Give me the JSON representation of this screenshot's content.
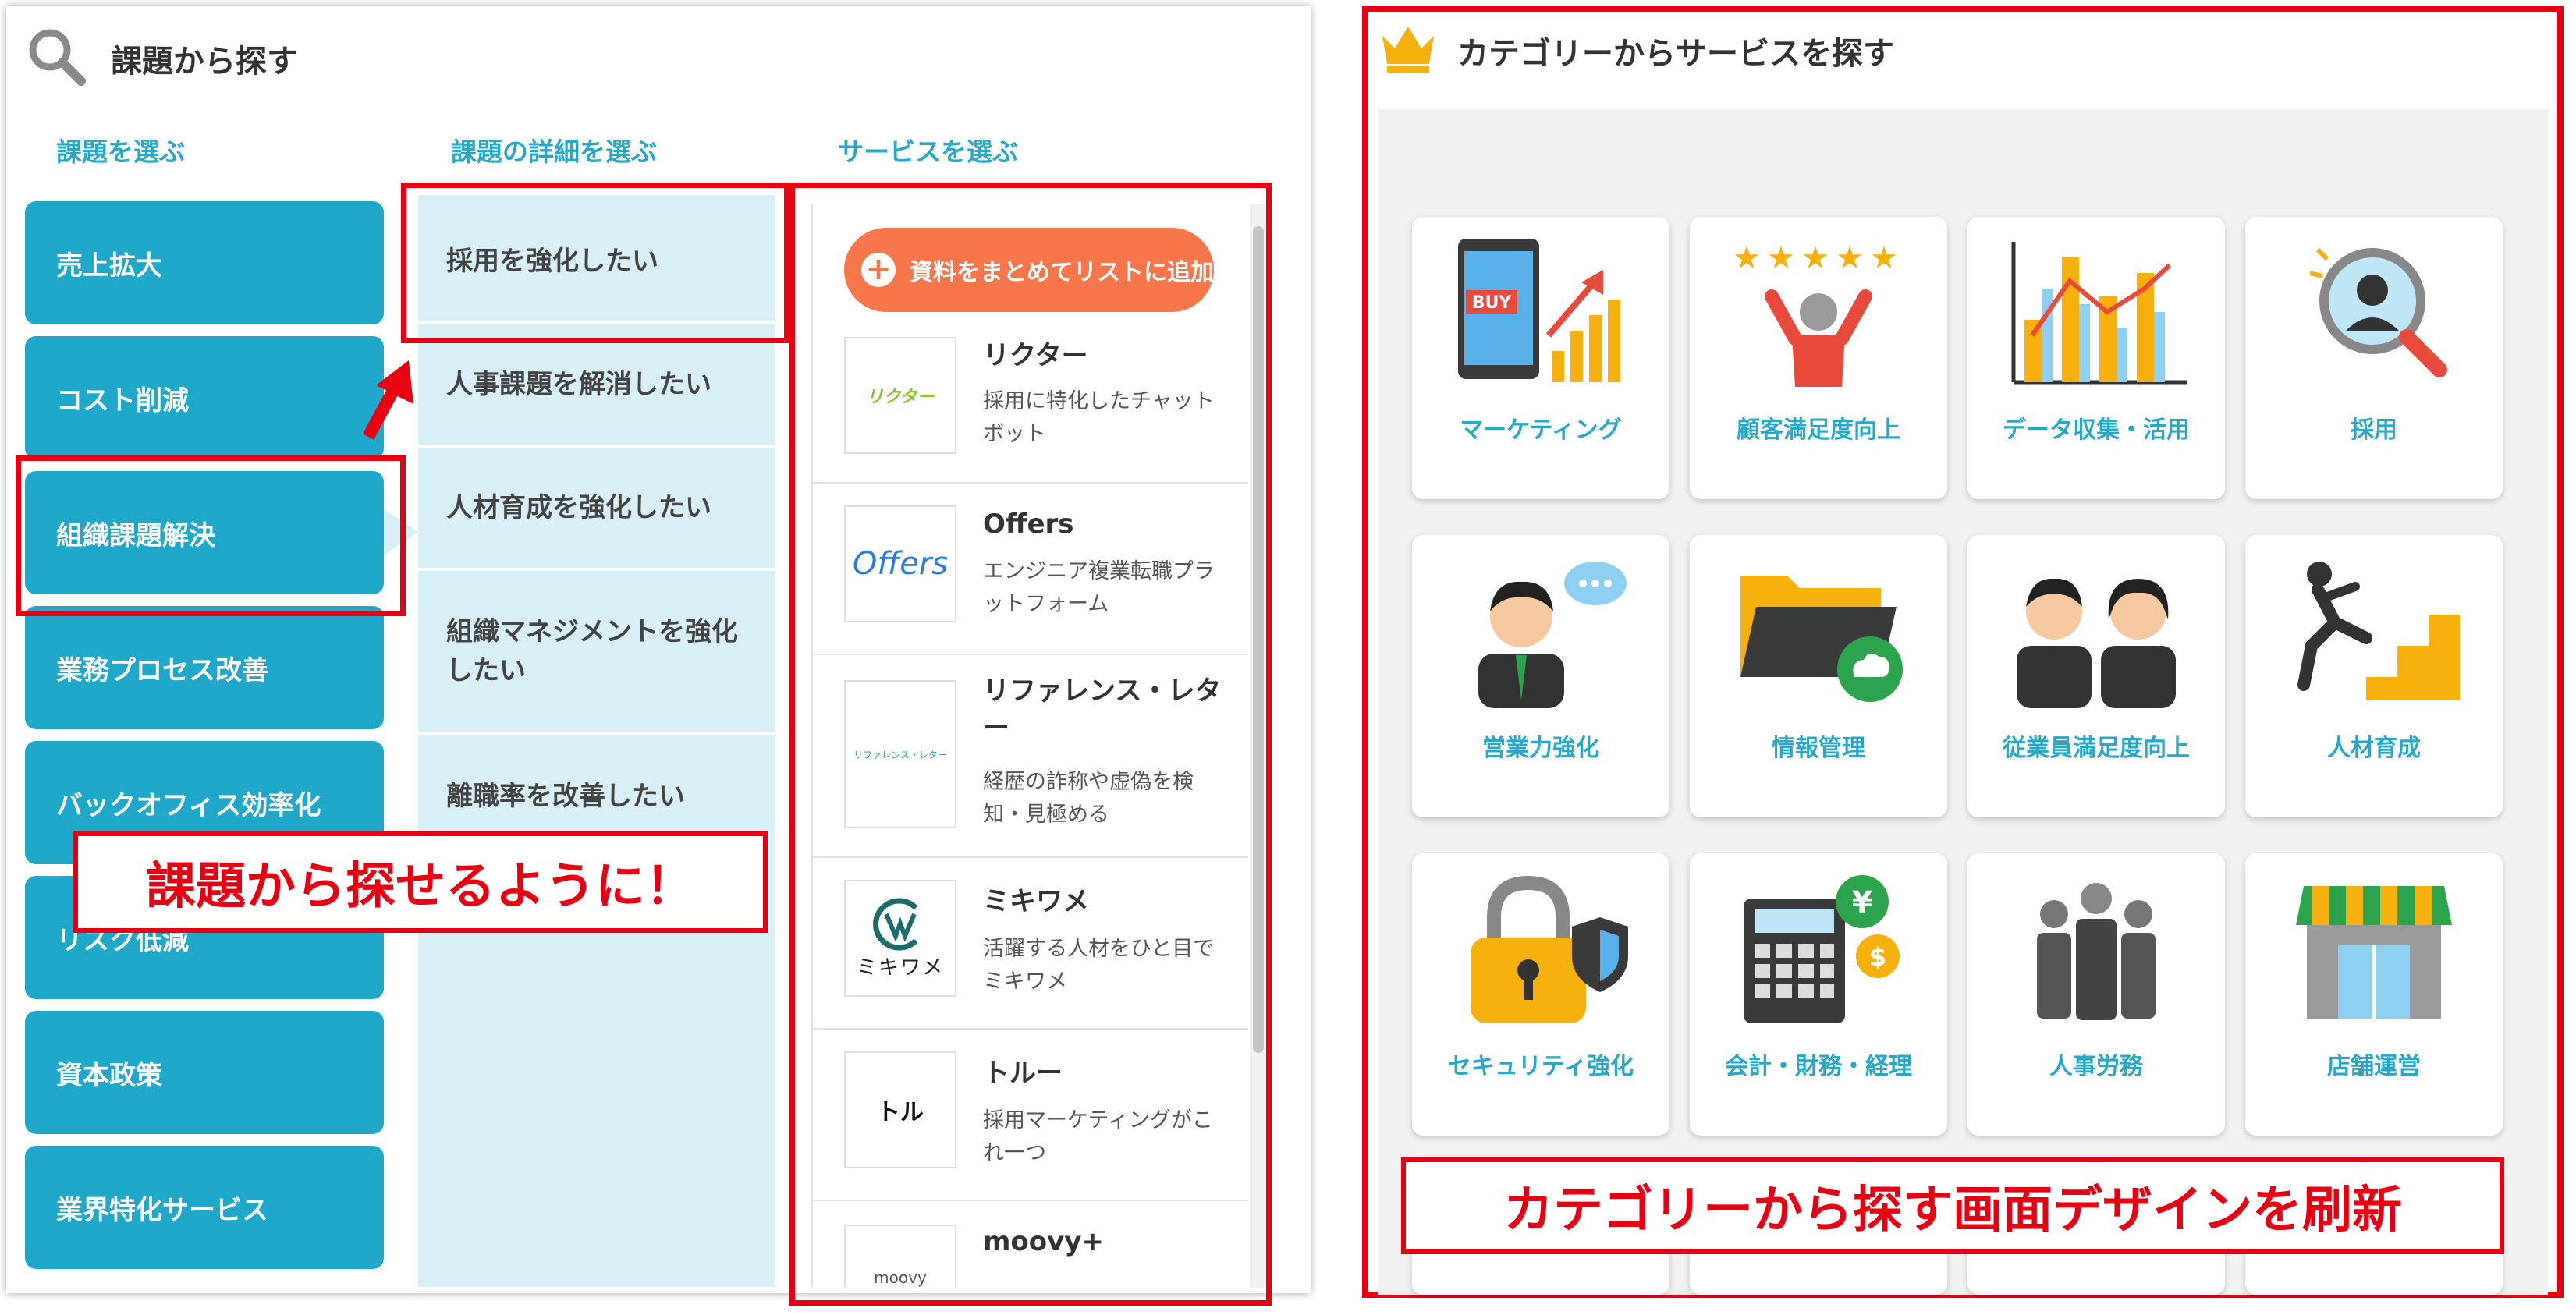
{
  "left_panel": {
    "title": "課題から探す",
    "columns": {
      "issue": "課題を選ぶ",
      "detail": "課題の詳細を選ぶ",
      "service": "サービスを選ぶ"
    },
    "issues": [
      "売上拡大",
      "コスト削減",
      "組織課題解決",
      "業務プロセス改善",
      "バックオフィス効率化",
      "リスク低減",
      "資本政策",
      "業界特化サービス"
    ],
    "details": [
      "採用を強化したい",
      "人事課題を解消したい",
      "人材育成を強化したい",
      "組織マネジメントを強化したい",
      "離職率を改善したい"
    ],
    "add_button": "資料をまとめてリストに追加",
    "services": [
      {
        "name": "リクター",
        "desc": "採用に特化したチャットボット",
        "logo": "リクター"
      },
      {
        "name": "Offers",
        "desc": "エンジニア複業転職プラットフォーム",
        "logo": "Offers"
      },
      {
        "name": "リファレンス・レター",
        "desc": "経歴の詐称や虚偽を検知・見極める",
        "logo": "リファレンス・レター"
      },
      {
        "name": "ミキワメ",
        "desc": "活躍する人材をひと目でミキワメ",
        "logo": "ミキワメ"
      },
      {
        "name": "トルー",
        "desc": "採用マーケティングがこれ一つ",
        "logo": "トル"
      },
      {
        "name": "moovy+",
        "desc": "",
        "logo": "moovy"
      }
    ],
    "callout": "課題から探せるように！"
  },
  "right_panel": {
    "title": "カテゴリーからサービスを探す",
    "categories": [
      "マーケティング",
      "顧客満足度向上",
      "データ収集・活用",
      "採用",
      "営業力強化",
      "情報管理",
      "従業員満足度向上",
      "人材育成",
      "セキュリティ強化",
      "会計・財務・経理",
      "人事労務",
      "店舗運営"
    ],
    "buy_label": "BUY",
    "yen_label": "¥",
    "dollar_label": "$",
    "callout": "カテゴリーから探す画面デザインを刷新"
  },
  "colors": {
    "accent": "#1fa8c9",
    "highlight": "#e60012",
    "orange": "#f5764a",
    "detail_bg": "#d8eff5"
  }
}
